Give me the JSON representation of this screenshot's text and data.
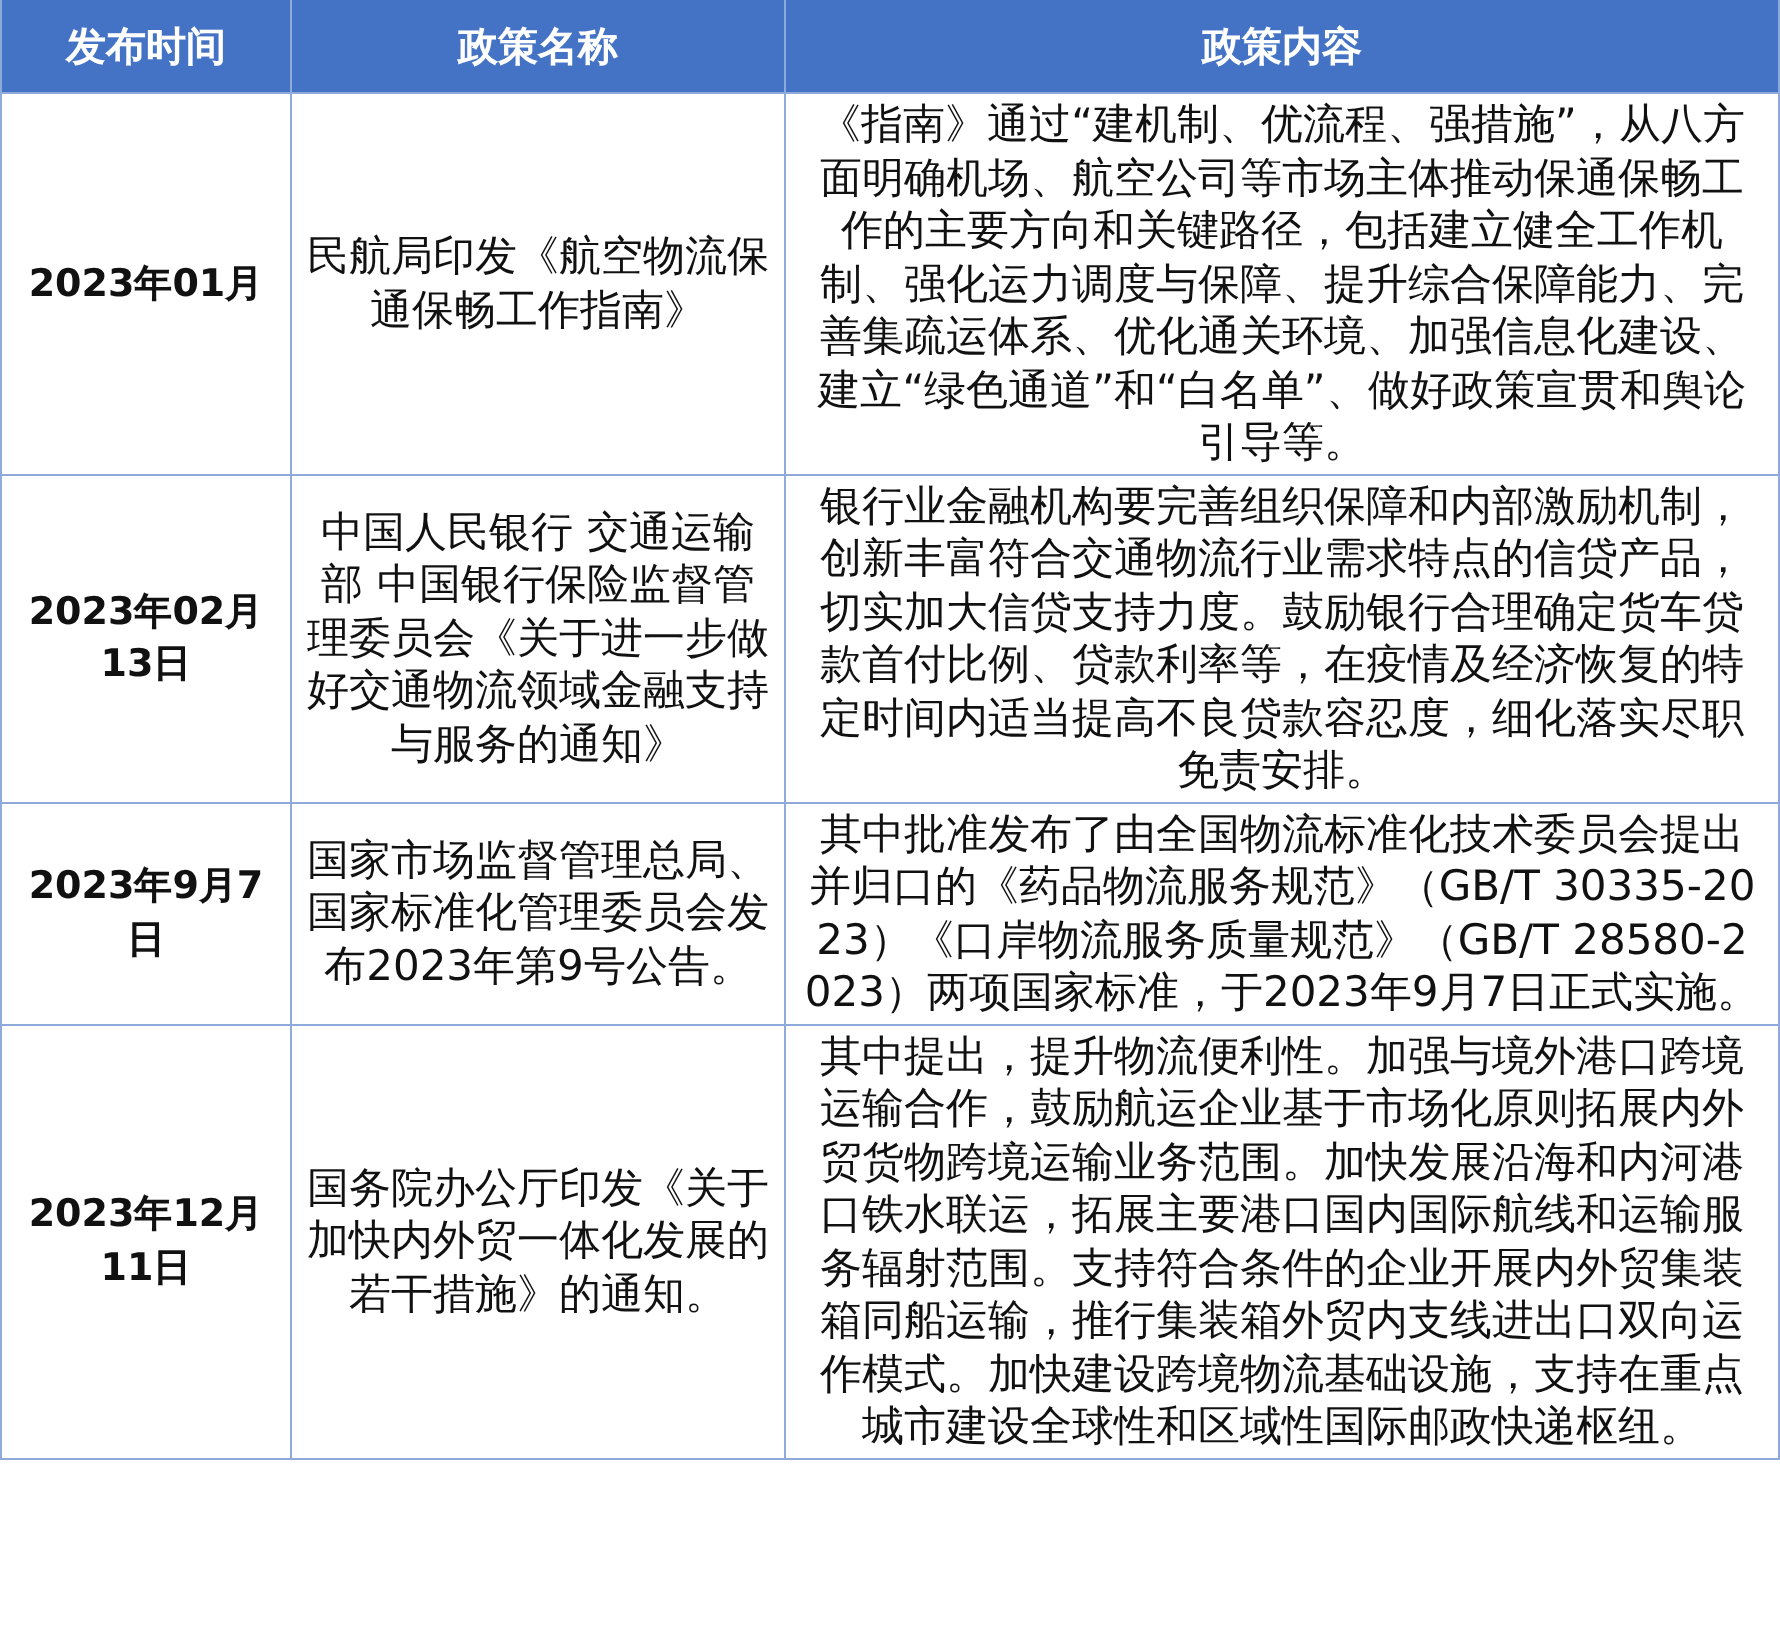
{
  "table": {
    "columns": [
      "发布时间",
      "政策名称",
      "政策内容"
    ],
    "rows": [
      {
        "date": "2023年01月",
        "name": "民航局印发《航空物流保通保畅工作指南》",
        "content": "《指南》通过“建机制、优流程、强措施”，从八方面明确机场、航空公司等市场主体推动保通保畅工作的主要方向和关键路径，包括建立健全工作机制、强化运力调度与保障、提升综合保障能力、完善集疏运体系、优化通关环境、加强信息化建设、建立“绿色通道”和“白名单”、做好政策宣贯和舆论引导等。"
      },
      {
        "date": "2023年02月13日",
        "name": "中国人民银行 交通运输部 中国银行保险监督管理委员会《关于进一步做好交通物流领域金融支持与服务的通知》",
        "content": "银行业金融机构要完善组织保障和内部激励机制，创新丰富符合交通物流行业需求特点的信贷产品，切实加大信贷支持力度。鼓励银行合理确定货车贷款首付比例、贷款利率等，在疫情及经济恢复的特定时间内适当提高不良贷款容忍度，细化落实尽职免责安排。"
      },
      {
        "date": "2023年9月7日",
        "name": "国家市场监督管理总局、国家标准化管理委员会发布2023年第9号公告。",
        "content": "其中批准发布了由全国物流标准化技术委员会提出并归口的《药品物流服务规范》（GB/T 30335-2023）《口岸物流服务质量规范》（GB/T 28580-2023）两项国家标准，于2023年9月7日正式实施。"
      },
      {
        "date": "2023年12月11日",
        "name": "国务院办公厅印发《关于加快内外贸一体化发展的若干措施》的通知。",
        "content": "其中提出，提升物流便利性。加强与境外港口跨境运输合作，鼓励航运企业基于市场化原则拓展内外贸货物跨境运输业务范围。加快发展沿海和内河港口铁水联运，拓展主要港口国内国际航线和运输服务辐射范围。支持符合条件的企业开展内外贸集装箱同船运输，推行集装箱外贸内支线进出口双向运作模式。加快建设跨境物流基础设施，支持在重点城市建设全球性和区域性国际邮政快递枢纽。"
      }
    ]
  }
}
